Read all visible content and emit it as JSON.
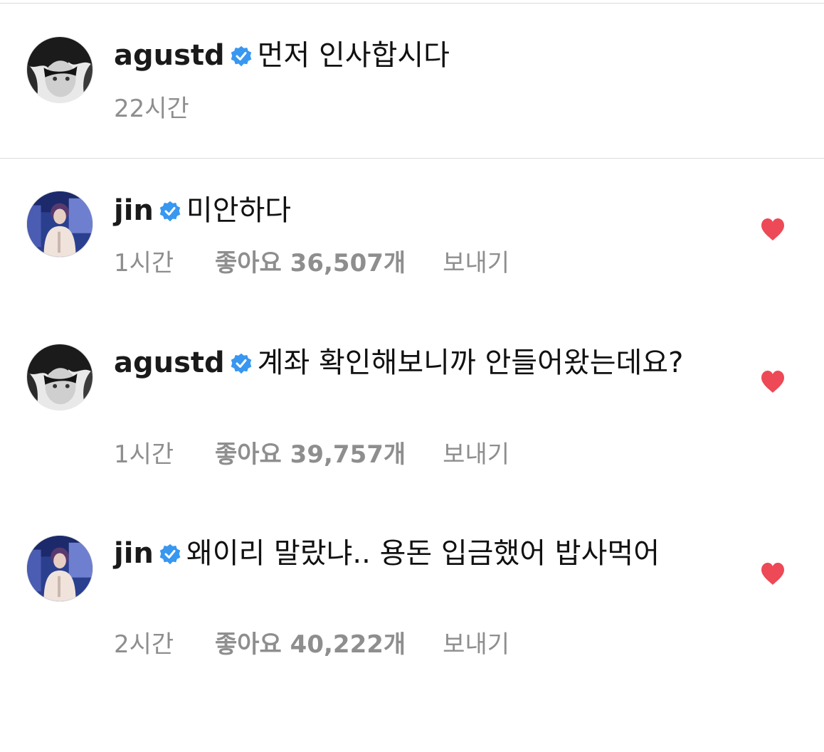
{
  "colors": {
    "verified_badge": "#3897f0",
    "heart": "#ed4956",
    "meta_text": "#8e8e8e",
    "divider": "#dbdbdb"
  },
  "caption": {
    "username": "agustd",
    "text": "먼저 인사합시다",
    "time": "22시간"
  },
  "comments": [
    {
      "username": "jin",
      "text": "미안하다",
      "time": "1시간",
      "likes": "좋아요 36,507개",
      "reply": "보내기",
      "liked": true
    },
    {
      "username": "agustd",
      "text": "계좌 확인해보니까 안들어왔는데요?",
      "time": "1시간",
      "likes": "좋아요 39,757개",
      "reply": "보내기",
      "liked": true
    },
    {
      "username": "jin",
      "text": "왜이리 말랐냐.. 용돈 입금했어 밥사먹어",
      "time": "2시간",
      "likes": "좋아요 40,222개",
      "reply": "보내기",
      "liked": true
    }
  ]
}
